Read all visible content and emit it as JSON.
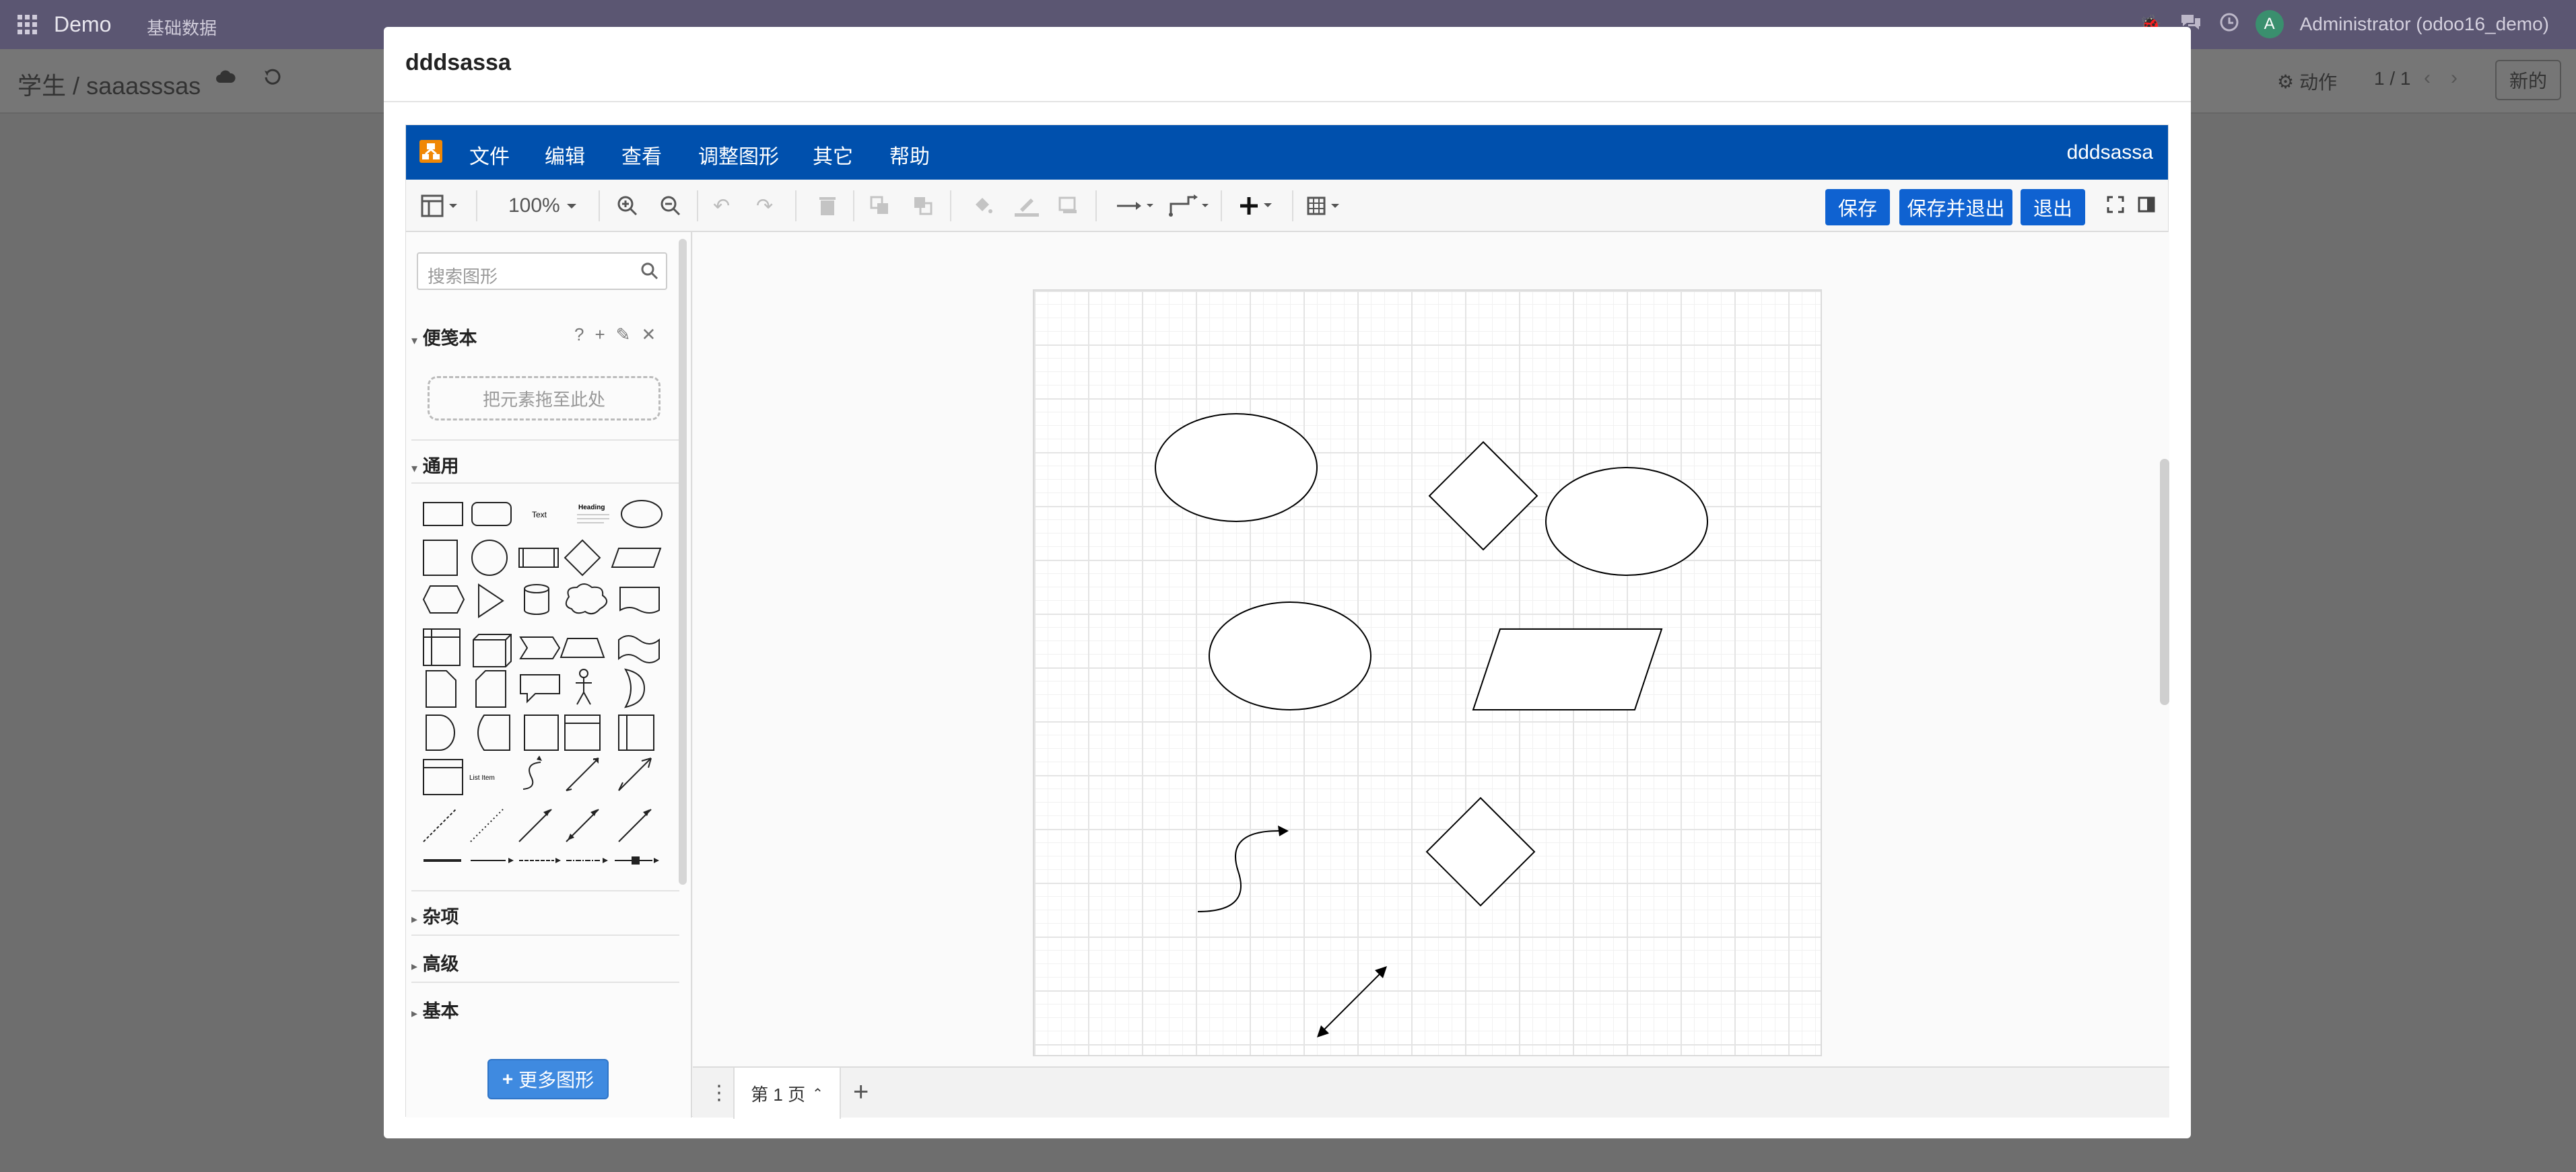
{
  "topnav": {
    "brand": "Demo",
    "menu": "基础数据",
    "user": "Administrator (odoo16_demo)",
    "avatar_letter": "A"
  },
  "control_panel": {
    "breadcrumb_parent": "学生",
    "breadcrumb_sep": "/",
    "breadcrumb_current": "saaasssas",
    "actions": "动作",
    "pager": "1 / 1",
    "new": "新的"
  },
  "modal": {
    "title": "dddsassa"
  },
  "drawio": {
    "menus": [
      "文件",
      "编辑",
      "查看",
      "调整图形",
      "其它",
      "帮助"
    ],
    "doc_name": "dddsassa",
    "zoom": "100%",
    "save": "保存",
    "save_exit": "保存并退出",
    "exit": "退出",
    "search_placeholder": "搜索图形",
    "scratchpad": "便笺本",
    "scratchpad_help": "?",
    "dropzone": "把元素拖至此处",
    "general": "通用",
    "misc": "杂项",
    "advanced": "高级",
    "basic": "基本",
    "more_shapes": "更多图形",
    "shape_text": "Text",
    "shape_heading": "Heading",
    "shape_listitem": "List Item",
    "page_tab": "第 1 页"
  }
}
